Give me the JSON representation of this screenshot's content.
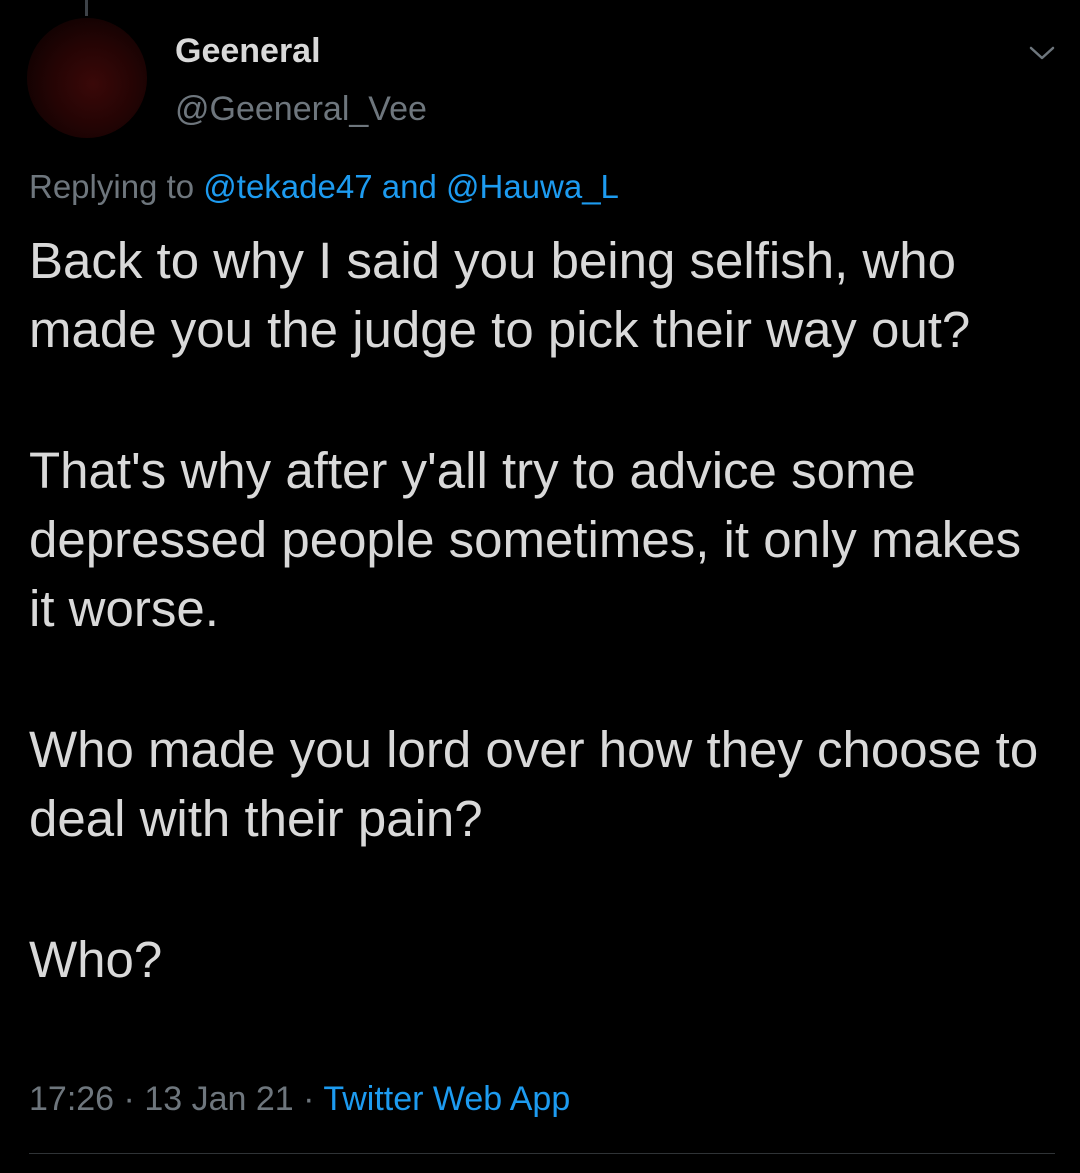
{
  "tweet": {
    "author": {
      "display_name": "Geeneral",
      "handle": "@Geeneral_Vee"
    },
    "replying_to": {
      "prefix": "Replying to",
      "first": "@tekade47",
      "joiner": "and",
      "second": "@Hauwa_L"
    },
    "paragraphs": [
      "Back to why I said you being selfish, who made you the judge to pick their way out?",
      "That's why after y'all try to advice  some depressed people sometimes, it only makes it worse.",
      "Who made you lord over how they choose to deal with their pain?",
      "Who?"
    ],
    "time": "17:26",
    "date": "13 Jan 21",
    "separator": "·",
    "source": "Twitter Web App"
  },
  "icons": {
    "menu": "chevron-down-icon",
    "avatar": "avatar-image"
  },
  "colors": {
    "background": "#000000",
    "text": "#d9d9d9",
    "secondary": "#6e767d",
    "accent": "#1d9bf0"
  }
}
